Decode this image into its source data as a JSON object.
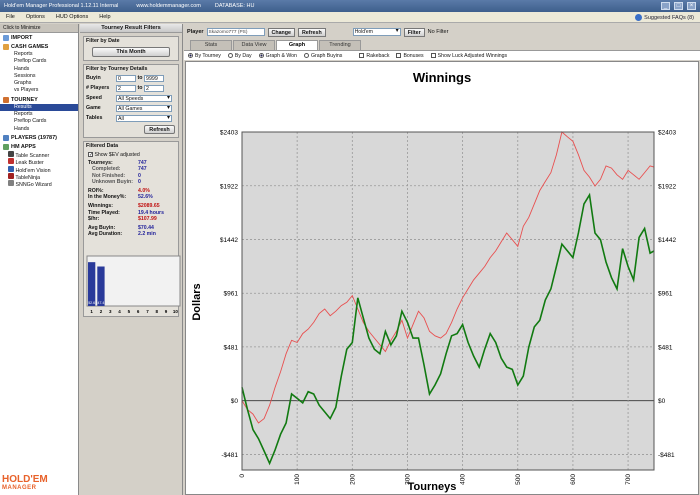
{
  "window": {
    "title": "Hold'em Manager Professional 1.12.11 Internal",
    "url": "www.holdemmanager.com",
    "db": "DATABASE: HU"
  },
  "menu": [
    "File",
    "Options",
    "HUD Options",
    "Help"
  ],
  "faq": "Suggested FAQs (8)",
  "nav": {
    "minimize": "Click to Minimize",
    "import": "IMPORT",
    "cash_games": "CASH GAMES",
    "cash_items": [
      "Reports",
      "Preflop Cards",
      "Hands",
      "Sessions",
      "Graphs",
      "vs Players"
    ],
    "tourney": "TOURNEY",
    "tourney_items": [
      "Results",
      "Reports",
      "Preflop Cards",
      "Hands"
    ],
    "players": "PLAYERS (19787)",
    "hm_apps": "HM APPS",
    "apps": [
      "Table Scanner",
      "Leak Buster",
      "Hold'em Vision",
      "TableNinja",
      "SNNGo Wizard"
    ],
    "logo": "HOLD'EM",
    "logo_sub": "MANAGER"
  },
  "filters": {
    "header": "Tourney Result Filters",
    "by_date": "Filter by Date",
    "this_month": "This Month",
    "by_details": "Filter by Tourney Details",
    "buyin_label": "Buyin",
    "buyin_from": "0",
    "buyin_to": "9999",
    "players_label": "# Players",
    "players_from": "2",
    "players_to": "2",
    "speed_label": "Speed",
    "speed_value": "All Speeds",
    "game_label": "Game",
    "game_value": "All Games",
    "tables_label": "Tables",
    "tables_value": "All",
    "refresh": "Refresh"
  },
  "filtered": {
    "title": "Filtered Data",
    "show_ev": "Show $EV adjusted",
    "tourneys_label": "Tourneys:",
    "tourneys": "747",
    "completed_label": "Completed:",
    "completed": "747",
    "not_finished_label": "Not Finished:",
    "not_finished": "0",
    "unknown_label": "Unknown Buyin:",
    "unknown": "0",
    "roi_label": "ROI%:",
    "roi": "4.0%",
    "itm_label": "In the Money%:",
    "itm": "52.6%",
    "winnings_label": "Winnings:",
    "winnings": "$2089.65",
    "time_label": "Time Played:",
    "time": "19.4 hours",
    "hr_label": "$/hr:",
    "hr": "$107.99",
    "avg_buyin_label": "Avg Buyin:",
    "avg_buyin": "$70.44",
    "avg_dur_label": "Avg Duration:",
    "avg_dur": "2.2 min",
    "finish_bars": [
      52.6,
      47.4,
      0,
      0,
      0,
      0,
      0,
      0,
      0,
      0
    ],
    "finish_bar_labels": [
      "52.6",
      "47.4"
    ],
    "finish_positions": [
      "1",
      "2",
      "3",
      "4",
      "5",
      "6",
      "7",
      "8",
      "9",
      "10"
    ]
  },
  "main": {
    "player_label": "Player",
    "player_name": "Skazomo777 (PS)",
    "change": "Change",
    "refresh": "Refresh",
    "game_select": "Hold'em",
    "filter": "Filter",
    "no_filter": "No Filter",
    "tabs": [
      "Stats",
      "Data View",
      "Graph",
      "Trending"
    ],
    "active_tab": "Graph",
    "options": [
      "By Tourney",
      "By Day",
      "Graph & Won",
      "Graph Buyins",
      "Rakeback",
      "Bonuses",
      "Show Luck Adjusted Winnings"
    ]
  },
  "chart_data": {
    "type": "line",
    "title": "Winnings",
    "xlabel": "Tourneys",
    "ylabel": "Dollars",
    "xlim": [
      0,
      747
    ],
    "ylim": [
      -620,
      2403
    ],
    "x_ticks": [
      0,
      100,
      200,
      300,
      400,
      500,
      600,
      700
    ],
    "y_ticks": [
      -481,
      0,
      481,
      961,
      1442,
      1922,
      2403
    ],
    "y_tick_labels": [
      "-$481",
      "$0",
      "$481",
      "$961",
      "$1442",
      "$1922",
      "$2403"
    ],
    "grid": true,
    "series": [
      {
        "color": "#e85050",
        "points": [
          [
            0,
            0
          ],
          [
            10,
            -80
          ],
          [
            20,
            -120
          ],
          [
            30,
            -200
          ],
          [
            40,
            -160
          ],
          [
            50,
            -40
          ],
          [
            60,
            120
          ],
          [
            70,
            260
          ],
          [
            80,
            420
          ],
          [
            90,
            540
          ],
          [
            100,
            520
          ],
          [
            110,
            600
          ],
          [
            120,
            640
          ],
          [
            130,
            700
          ],
          [
            140,
            780
          ],
          [
            150,
            820
          ],
          [
            160,
            760
          ],
          [
            170,
            800
          ],
          [
            180,
            850
          ],
          [
            190,
            880
          ],
          [
            200,
            940
          ],
          [
            210,
            820
          ],
          [
            220,
            700
          ],
          [
            230,
            620
          ],
          [
            240,
            560
          ],
          [
            250,
            500
          ],
          [
            260,
            440
          ],
          [
            270,
            540
          ],
          [
            280,
            620
          ],
          [
            290,
            720
          ],
          [
            300,
            560
          ],
          [
            310,
            680
          ],
          [
            320,
            800
          ],
          [
            330,
            740
          ],
          [
            340,
            620
          ],
          [
            350,
            580
          ],
          [
            360,
            560
          ],
          [
            370,
            600
          ],
          [
            380,
            700
          ],
          [
            390,
            820
          ],
          [
            400,
            920
          ],
          [
            410,
            1000
          ],
          [
            420,
            1080
          ],
          [
            430,
            1140
          ],
          [
            440,
            1200
          ],
          [
            450,
            1280
          ],
          [
            460,
            1340
          ],
          [
            470,
            1420
          ],
          [
            480,
            1500
          ],
          [
            490,
            1440
          ],
          [
            500,
            1380
          ],
          [
            510,
            1560
          ],
          [
            520,
            1640
          ],
          [
            530,
            1760
          ],
          [
            540,
            1880
          ],
          [
            550,
            1960
          ],
          [
            560,
            2040
          ],
          [
            570,
            2200
          ],
          [
            580,
            2403
          ],
          [
            590,
            2360
          ],
          [
            600,
            2320
          ],
          [
            610,
            2200
          ],
          [
            620,
            2060
          ],
          [
            630,
            2000
          ],
          [
            640,
            1920
          ],
          [
            650,
            1980
          ],
          [
            660,
            2100
          ],
          [
            670,
            2080
          ],
          [
            680,
            2020
          ],
          [
            690,
            1980
          ],
          [
            700,
            2060
          ],
          [
            710,
            2020
          ],
          [
            720,
            1980
          ],
          [
            730,
            2040
          ],
          [
            740,
            2100
          ],
          [
            747,
            2089
          ]
        ]
      },
      {
        "color": "#117a11",
        "points": [
          [
            0,
            120
          ],
          [
            10,
            -80
          ],
          [
            20,
            -260
          ],
          [
            30,
            -340
          ],
          [
            40,
            -450
          ],
          [
            50,
            -560
          ],
          [
            60,
            -440
          ],
          [
            70,
            -300
          ],
          [
            80,
            -200
          ],
          [
            90,
            60
          ],
          [
            100,
            20
          ],
          [
            110,
            -20
          ],
          [
            120,
            80
          ],
          [
            130,
            60
          ],
          [
            140,
            -40
          ],
          [
            150,
            -100
          ],
          [
            160,
            -160
          ],
          [
            170,
            -60
          ],
          [
            180,
            220
          ],
          [
            190,
            460
          ],
          [
            200,
            520
          ],
          [
            210,
            920
          ],
          [
            220,
            740
          ],
          [
            230,
            560
          ],
          [
            240,
            460
          ],
          [
            250,
            420
          ],
          [
            260,
            620
          ],
          [
            270,
            500
          ],
          [
            280,
            580
          ],
          [
            290,
            800
          ],
          [
            300,
            700
          ],
          [
            310,
            560
          ],
          [
            320,
            560
          ],
          [
            330,
            320
          ],
          [
            340,
            60
          ],
          [
            350,
            140
          ],
          [
            360,
            240
          ],
          [
            370,
            420
          ],
          [
            380,
            580
          ],
          [
            390,
            600
          ],
          [
            400,
            680
          ],
          [
            410,
            520
          ],
          [
            420,
            400
          ],
          [
            430,
            300
          ],
          [
            440,
            460
          ],
          [
            450,
            600
          ],
          [
            460,
            520
          ],
          [
            470,
            380
          ],
          [
            480,
            300
          ],
          [
            490,
            280
          ],
          [
            500,
            140
          ],
          [
            510,
            220
          ],
          [
            520,
            480
          ],
          [
            530,
            660
          ],
          [
            540,
            720
          ],
          [
            550,
            900
          ],
          [
            560,
            1000
          ],
          [
            570,
            1200
          ],
          [
            580,
            1400
          ],
          [
            590,
            1340
          ],
          [
            600,
            1280
          ],
          [
            610,
            1500
          ],
          [
            620,
            1760
          ],
          [
            630,
            1840
          ],
          [
            640,
            1500
          ],
          [
            650,
            1440
          ],
          [
            660,
            1240
          ],
          [
            670,
            1100
          ],
          [
            680,
            1000
          ],
          [
            690,
            1360
          ],
          [
            700,
            1200
          ],
          [
            710,
            1080
          ],
          [
            720,
            1460
          ],
          [
            730,
            1540
          ],
          [
            740,
            1320
          ],
          [
            747,
            1340
          ]
        ]
      }
    ]
  }
}
